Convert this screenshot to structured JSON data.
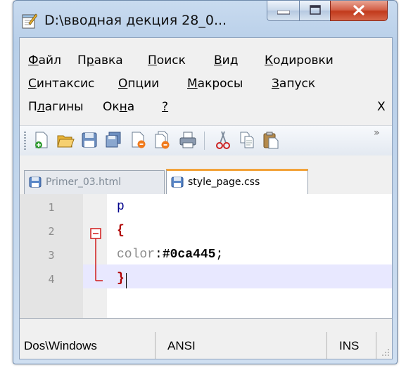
{
  "window": {
    "title": "D:\\вводная декция 28_0..."
  },
  "menu": {
    "row1": [
      {
        "label": "Файл",
        "accel": "Ф"
      },
      {
        "label": "Правка",
        "accel": "р"
      },
      {
        "label": "Поиск",
        "accel": "П"
      },
      {
        "label": "Вид",
        "accel": "В"
      },
      {
        "label": "Кодировки",
        "accel": "К"
      }
    ],
    "row2": [
      {
        "label": "Синтаксис",
        "accel": "С"
      },
      {
        "label": "Опции",
        "accel": "О"
      },
      {
        "label": "Макросы",
        "accel": "М"
      },
      {
        "label": "Запуск",
        "accel": "З"
      }
    ],
    "row3": [
      {
        "label": "Плагины",
        "accel": "л"
      },
      {
        "label": "Окна",
        "accel": "н"
      },
      {
        "label": "?",
        "accel": "?"
      }
    ],
    "close_doc": "X"
  },
  "toolbar": {
    "buttons": [
      "new-file-icon",
      "open-file-icon",
      "save-icon",
      "save-all-icon",
      "close-icon",
      "close-all-icon",
      "print-icon",
      "cut-icon",
      "copy-icon",
      "paste-icon"
    ],
    "overflow": "»"
  },
  "tabs": [
    {
      "label": "Primer_03.html",
      "active": false
    },
    {
      "label": "style_page.css",
      "active": true
    }
  ],
  "editor": {
    "lines": [
      {
        "num": "1",
        "text": "p"
      },
      {
        "num": "2",
        "text": "{"
      },
      {
        "num": "3",
        "prop": "color",
        "sep": ":",
        "value": "#0ca445",
        "end": ";"
      },
      {
        "num": "4",
        "text": "}"
      }
    ],
    "colors": {
      "selector": "#00008b",
      "brace": "#000000",
      "property": "#8b8b8b",
      "value": "#000000",
      "fold": "#d11a1a",
      "current_line": "#e8e8ff"
    }
  },
  "status": {
    "eol": "Dos\\Windows",
    "encoding": "ANSI",
    "mode": "INS"
  }
}
